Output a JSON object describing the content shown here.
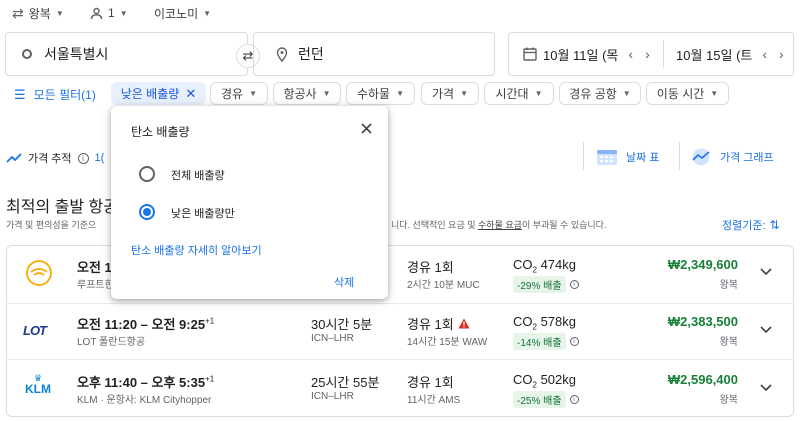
{
  "trip_bar": {
    "trip_type": "왕복",
    "passengers": "1",
    "cabin": "이코노미"
  },
  "search": {
    "origin": "서울특별시",
    "destination": "런던",
    "depart_date": "10월 11일 (목",
    "return_date": "10월 15일 (트"
  },
  "filters": {
    "all_filters": "모든 필터(1)",
    "chips": [
      "낮은 배출량",
      "경유",
      "항공사",
      "수하물",
      "가격",
      "시간대",
      "경유 공항",
      "이동 시간"
    ]
  },
  "tracking": {
    "label": "가격 추적",
    "partial": "1("
  },
  "tools": {
    "date_grid": "날짜 표",
    "price_graph": "가격 그래프"
  },
  "results": {
    "heading": "최적의 출발 항공",
    "subtext_left": "가격 및 편의성을 기준으",
    "subtext_right_a": "니다. 선택적인 요금 및 ",
    "subtext_link": "수하물 요금",
    "subtext_right_b": "이 부과될 수 있습니다.",
    "sort_label": "정렬기준:"
  },
  "flights": [
    {
      "airline_icon": "lufthansa-logo",
      "times": "오전 1",
      "sup": "",
      "airline": "루프트한",
      "duration": "",
      "route": "",
      "stops": "경유 1회",
      "stop_detail": "2시간 10분 MUC",
      "co2_prefix": "CO",
      "co2_sub": "2",
      "co2_value": " 474kg",
      "emissions": "-29% 배출",
      "price": "₩2,349,600",
      "trip": "왕복",
      "warning": false
    },
    {
      "airline_icon": "lot-logo",
      "times": "오전 11:20 – 오전 9:25",
      "sup": "+1",
      "airline": "LOT 폴란드항공",
      "duration": "30시간 5분",
      "route": "ICN–LHR",
      "stops": "경유 1회",
      "stop_detail": "14시간 15분 WAW",
      "co2_prefix": "CO",
      "co2_sub": "2",
      "co2_value": " 578kg",
      "emissions": "-14% 배출",
      "price": "₩2,383,500",
      "trip": "왕복",
      "warning": true
    },
    {
      "airline_icon": "klm-logo",
      "times": "오후 11:40 – 오후 5:35",
      "sup": "+1",
      "airline": "KLM · 운항사: KLM Cityhopper",
      "duration": "25시간 55분",
      "route": "ICN–LHR",
      "stops": "경유 1회",
      "stop_detail": "11시간 AMS",
      "co2_prefix": "CO",
      "co2_sub": "2",
      "co2_value": " 502kg",
      "emissions": "-25% 배출",
      "price": "₩2,596,400",
      "trip": "왕복",
      "warning": false
    }
  ],
  "popup": {
    "title": "탄소 배출량",
    "option_all": "전체 배출량",
    "option_low": "낮은 배출량만",
    "selected": "낮은 배출량만",
    "learn_more": "탄소 배출량 자세히 알아보기",
    "clear": "삭제"
  },
  "colors": {
    "accent": "#1a73e8",
    "price": "#188038",
    "emissions_bg": "#e6f4ea"
  }
}
